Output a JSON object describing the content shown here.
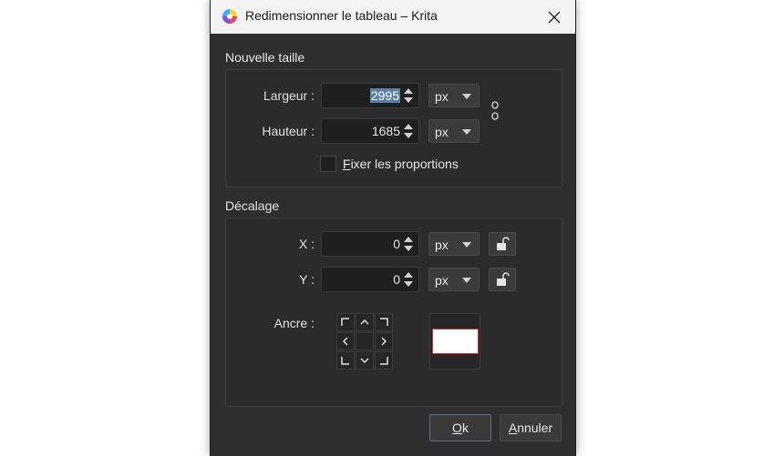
{
  "window": {
    "title": "Redimensionner le tableau – Krita"
  },
  "new_size": {
    "group_title": "Nouvelle taille",
    "width": {
      "label": "Largeur :",
      "value": "2995",
      "unit": "px"
    },
    "height": {
      "label": "Hauteur :",
      "value": "1685",
      "unit": "px"
    },
    "keep_ratio": {
      "label_mnemonic": "F",
      "label_rest": "ixer les proportions",
      "checked": false
    }
  },
  "offset": {
    "group_title": "Décalage",
    "x": {
      "label": "X :",
      "value": "0",
      "unit": "px"
    },
    "y": {
      "label": "Y :",
      "value": "0",
      "unit": "px"
    },
    "anchor_label": "Ancre :"
  },
  "buttons": {
    "ok_mnemonic": "O",
    "ok_rest": "k",
    "cancel_mnemonic": "A",
    "cancel_rest": "nnuler"
  },
  "colors": {
    "dialog_bg": "#2e2e2e",
    "titlebar_bg": "#f3f3f3",
    "selection": "#5b7fa6",
    "preview_border": "#d03030"
  }
}
